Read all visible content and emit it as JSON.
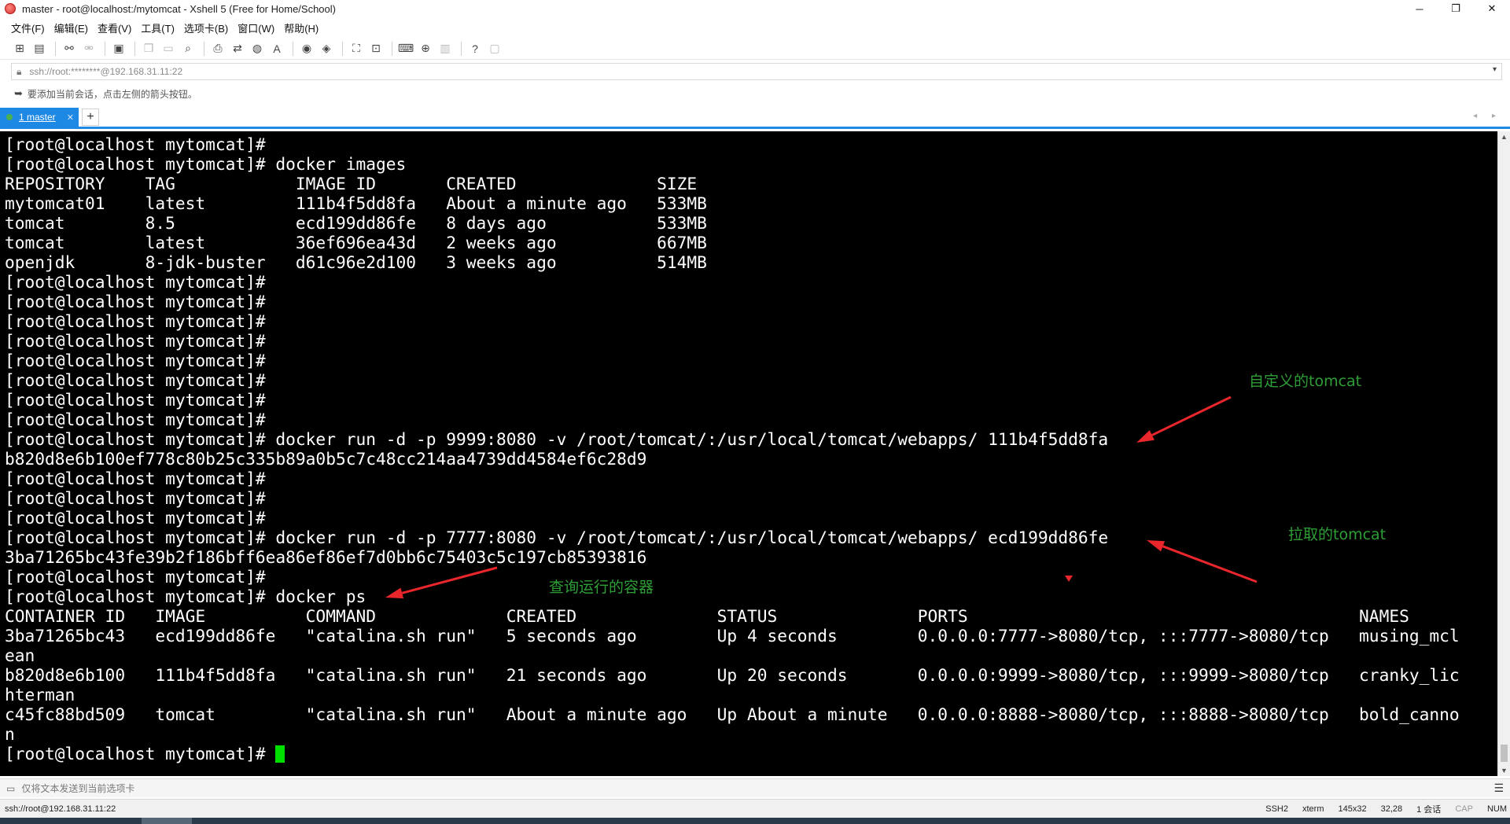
{
  "window": {
    "title": "master - root@localhost:/mytomcat - Xshell 5 (Free for Home/School)",
    "minimize": "─",
    "maximize": "❐",
    "close": "✕"
  },
  "menu": [
    "文件(F)",
    "编辑(E)",
    "查看(V)",
    "工具(T)",
    "选项卡(B)",
    "窗口(W)",
    "帮助(H)"
  ],
  "address": {
    "value": "ssh://root:********@192.168.31.11:22",
    "dropdown": "▾"
  },
  "hint": "要添加当前会话，点击左侧的箭头按钮。",
  "tab": {
    "label": "1 master",
    "close": "✕",
    "add": "+",
    "nav": "◂ ▸"
  },
  "terminal": {
    "lines": [
      "[root@localhost mytomcat]#",
      "[root@localhost mytomcat]# docker images",
      "REPOSITORY    TAG            IMAGE ID       CREATED              SIZE",
      "mytomcat01    latest         111b4f5dd8fa   About a minute ago   533MB",
      "tomcat        8.5            ecd199dd86fe   8 days ago           533MB",
      "tomcat        latest         36ef696ea43d   2 weeks ago          667MB",
      "openjdk       8-jdk-buster   d61c96e2d100   3 weeks ago          514MB",
      "[root@localhost mytomcat]#",
      "[root@localhost mytomcat]#",
      "[root@localhost mytomcat]#",
      "[root@localhost mytomcat]#",
      "[root@localhost mytomcat]#",
      "[root@localhost mytomcat]#",
      "[root@localhost mytomcat]#",
      "[root@localhost mytomcat]#",
      "[root@localhost mytomcat]# docker run -d -p 9999:8080 -v /root/tomcat/:/usr/local/tomcat/webapps/ 111b4f5dd8fa",
      "b820d8e6b100ef778c80b25c335b89a0b5c7c48cc214aa4739dd4584ef6c28d9",
      "[root@localhost mytomcat]#",
      "[root@localhost mytomcat]#",
      "[root@localhost mytomcat]#",
      "[root@localhost mytomcat]# docker run -d -p 7777:8080 -v /root/tomcat/:/usr/local/tomcat/webapps/ ecd199dd86fe",
      "3ba71265bc43fe39b2f186bff6ea86ef86ef7d0bb6c75403c5c197cb85393816",
      "[root@localhost mytomcat]#",
      "[root@localhost mytomcat]# docker ps",
      "CONTAINER ID   IMAGE          COMMAND             CREATED              STATUS              PORTS                                       NAMES",
      "3ba71265bc43   ecd199dd86fe   \"catalina.sh run\"   5 seconds ago        Up 4 seconds        0.0.0.0:7777->8080/tcp, :::7777->8080/tcp   musing_mcl",
      "ean",
      "b820d8e6b100   111b4f5dd8fa   \"catalina.sh run\"   21 seconds ago       Up 20 seconds       0.0.0.0:9999->8080/tcp, :::9999->8080/tcp   cranky_lic",
      "hterman",
      "c45fc88bd509   tomcat         \"catalina.sh run\"   About a minute ago   Up About a minute   0.0.0.0:8888->8080/tcp, :::8888->8080/tcp   bold_canno",
      "n"
    ],
    "prompt_last": "[root@localhost mytomcat]# "
  },
  "annotations": {
    "custom_tomcat": "自定义的tomcat",
    "pulled_tomcat": "拉取的tomcat",
    "query_containers": "查询运行的容器",
    "color": "#2e9e36",
    "arrow_color": "#e8262b"
  },
  "sendbar": {
    "text": "仅将文本发送到当前选项卡",
    "menu": "☰"
  },
  "status": {
    "connection": "ssh://root@192.168.31.11:22",
    "protocol": "SSH2",
    "term": "xterm",
    "size": "145x32",
    "position": "32,28",
    "sessions": "1 会话",
    "cap": "CAP",
    "num": "NUM"
  },
  "icons": {
    "app": "xshell-logo-icon",
    "lock": "lock-icon",
    "hint": "arrow-bookmark-icon"
  }
}
